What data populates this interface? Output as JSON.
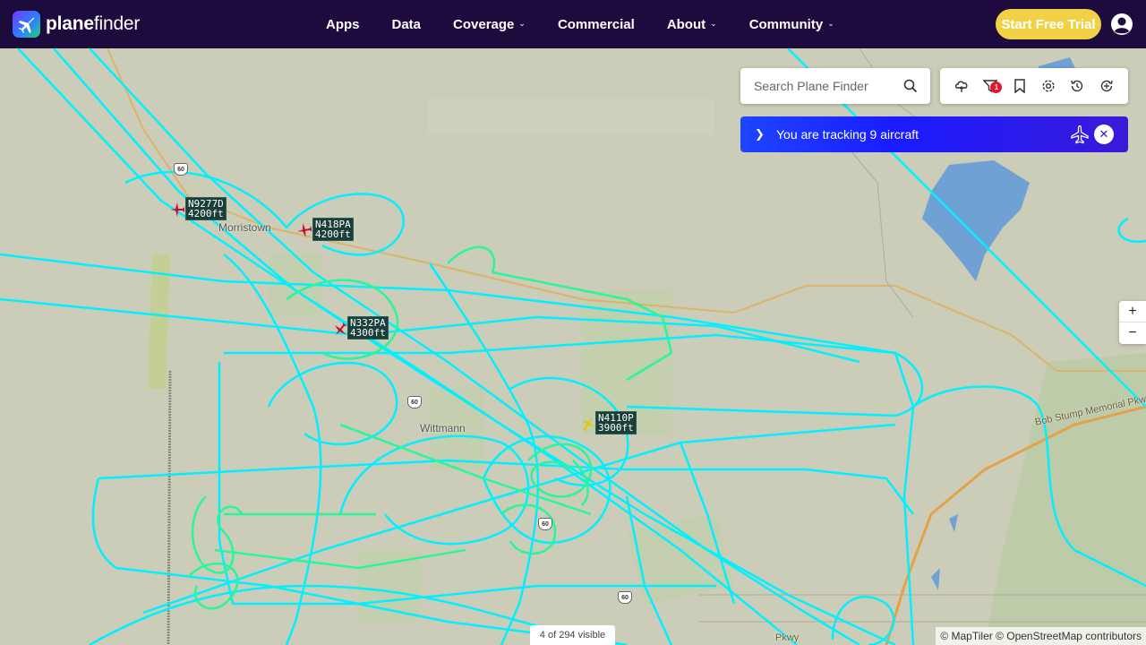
{
  "brand": {
    "name_bold": "plane",
    "name_regular": "finder"
  },
  "nav": [
    {
      "label": "Apps",
      "dropdown": false
    },
    {
      "label": "Data",
      "dropdown": false
    },
    {
      "label": "Coverage",
      "dropdown": true
    },
    {
      "label": "Commercial",
      "dropdown": false
    },
    {
      "label": "About",
      "dropdown": true
    },
    {
      "label": "Community",
      "dropdown": true
    }
  ],
  "cta": {
    "trial_label": "Start Free Trial"
  },
  "search": {
    "placeholder": "Search Plane Finder"
  },
  "toolbar": {
    "filter_badge": "1",
    "icons": [
      "weather-icon",
      "filter-icon",
      "bookmark-icon",
      "settings-icon",
      "history-icon",
      "playback-icon"
    ]
  },
  "tracking": {
    "text": "You are tracking 9 aircraft"
  },
  "zoom": {
    "in": "+",
    "out": "−"
  },
  "aircraft": [
    {
      "callsign": "N9277D",
      "altitude": "4200ft"
    },
    {
      "callsign": "N418PA",
      "altitude": "4200ft"
    },
    {
      "callsign": "N332PA",
      "altitude": "4300ft"
    },
    {
      "callsign": "N4110P",
      "altitude": "3900ft"
    }
  ],
  "places": {
    "morristown": "Morristown",
    "wittmann": "Wittmann",
    "bob_stump": "Bob Stump Memorial Pkwy",
    "pkwy": "Pkwy"
  },
  "shields": {
    "us60a": "60",
    "us60b": "60",
    "us60c": "60",
    "us60d": "60"
  },
  "status": {
    "visible": "4 of 294 visible"
  },
  "attribution": "© MapTiler © OpenStreetMap contributors",
  "colors": {
    "nav_bg": "#1e0b3d",
    "cta": "#f1d247",
    "track_cyan": "#00f0ff",
    "track_green": "#2af59a",
    "aircraft_red": "#c8102e",
    "tracking_bar": "#1a1bff"
  }
}
